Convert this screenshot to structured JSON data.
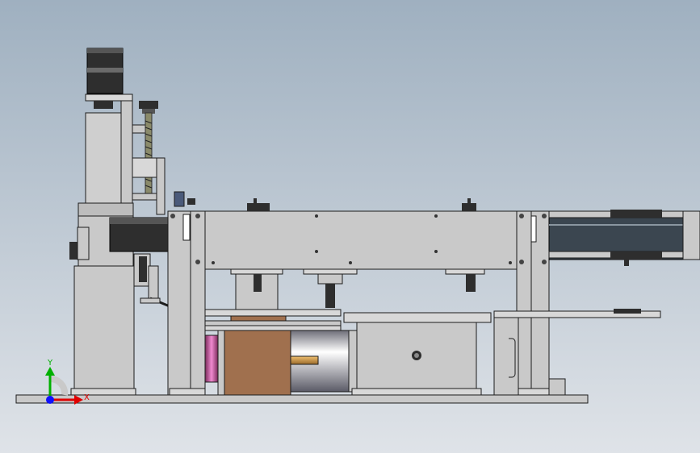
{
  "viewport": {
    "background_top": "#9fb0c0",
    "background_bottom": "#dfe3e8"
  },
  "colors": {
    "part_gray": "#c9c9c9",
    "part_light": "#d8d8d8",
    "part_dark": "#2e2e2e",
    "outline": "#1c1c1c",
    "copper": "#a0704e",
    "brass": "#d9a14a",
    "magenta": "#c0508e",
    "steel_dark": "#3b4650",
    "axis_x": "#e00000",
    "axis_y": "#00b000",
    "axis_z": "#1010ff"
  },
  "triad": {
    "x_label": "X",
    "y_label": "Y"
  }
}
